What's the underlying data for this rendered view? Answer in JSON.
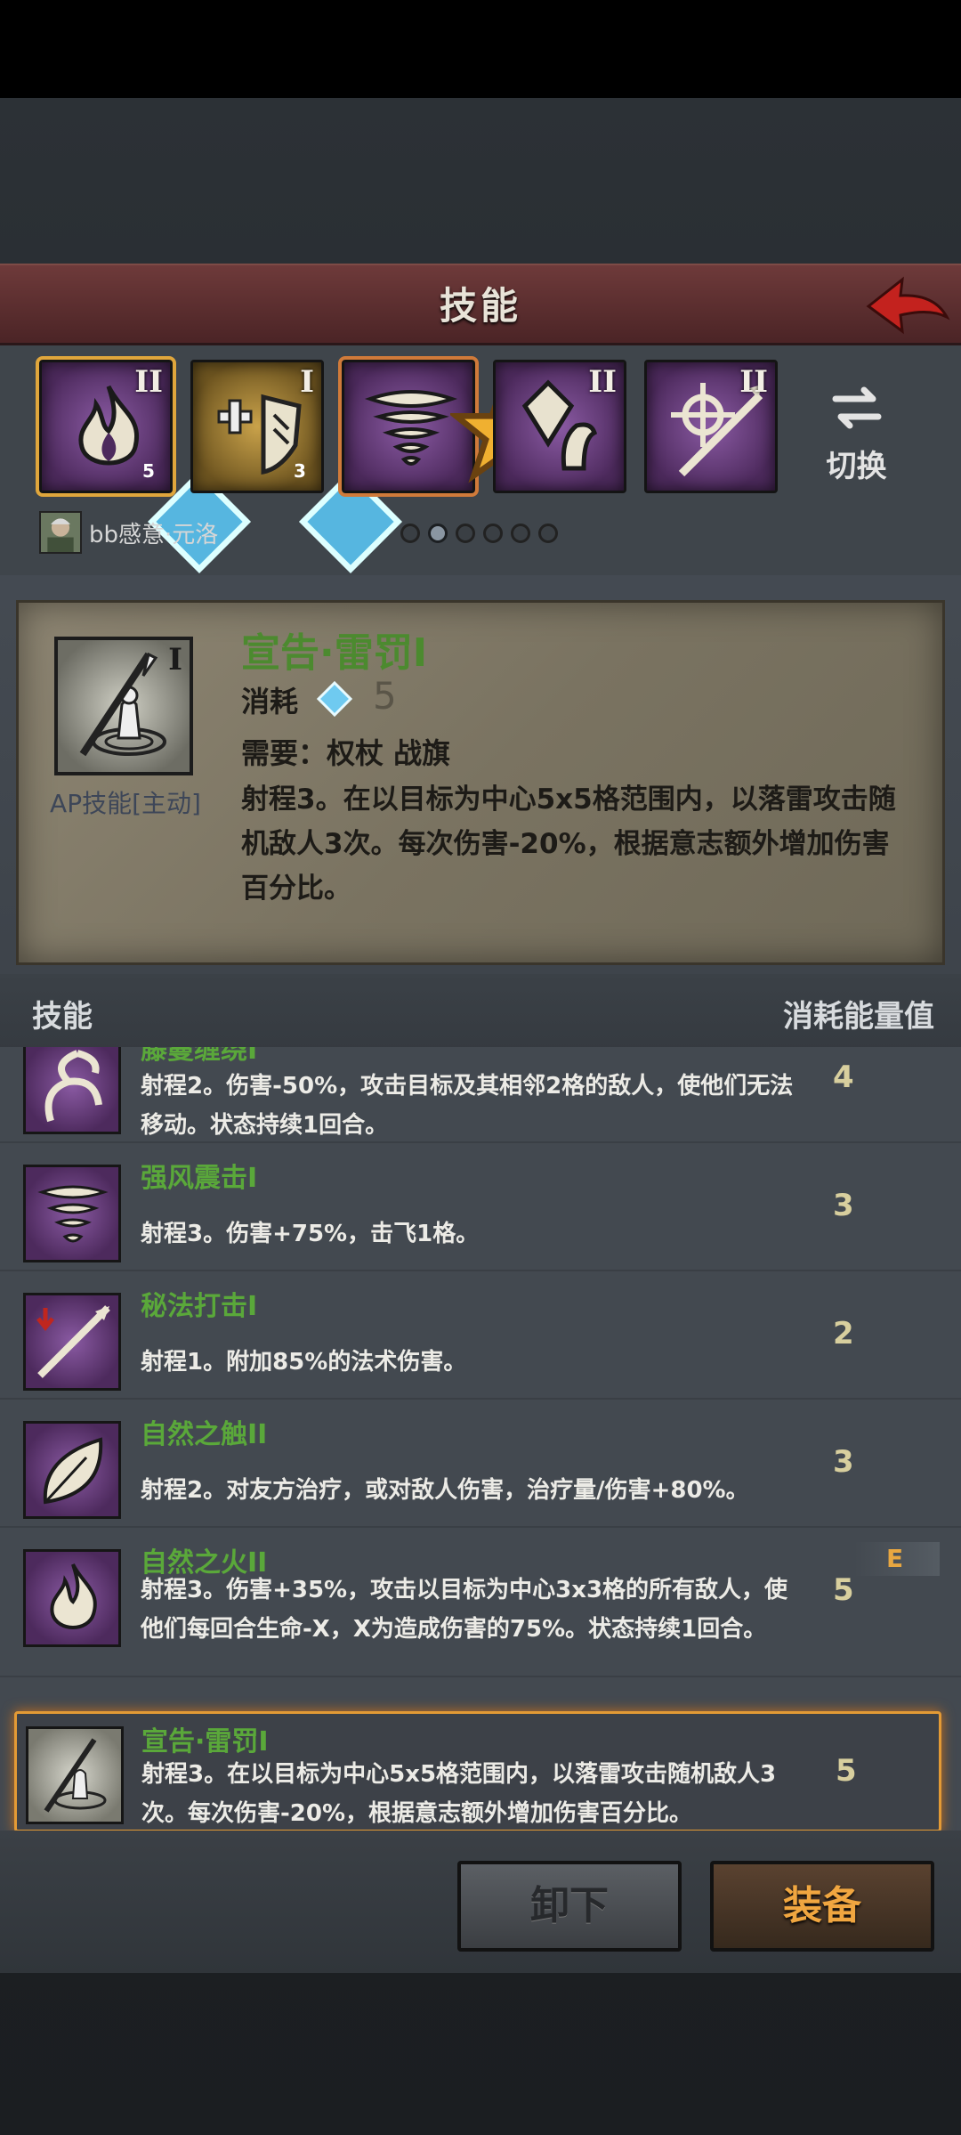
{
  "header": {
    "title": "技能",
    "back_icon": "back-arrow-icon"
  },
  "skill_slots": [
    {
      "icon": "flame-icon",
      "tier": "II",
      "cost": "5",
      "selected": true
    },
    {
      "icon": "heal-shield-icon",
      "tier": "I",
      "cost": "3",
      "gold": true
    },
    {
      "icon": "tornado-icon",
      "tier": "",
      "starred": true
    },
    {
      "icon": "crystal-hand-icon",
      "tier": "II"
    },
    {
      "icon": "target-staff-icon",
      "tier": "II"
    }
  ],
  "switch": {
    "label": "切换",
    "icon": "switch-arrows-icon"
  },
  "character": {
    "name": "bb感意·元洛"
  },
  "pager": {
    "pages": 6,
    "current": 2
  },
  "detail": {
    "name": "宣告·雷罚I",
    "tier": "I",
    "type": "AP技能[主动]",
    "cost_label": "消耗",
    "cost_value": "5",
    "requirement": "需要：权杖 战旗",
    "description": "射程3。在以目标为中心5x5格范围内，以落雷攻击随机敌人3次。每次伤害-20%，根据意志额外增加伤害百分比。"
  },
  "list_header": {
    "left": "技能",
    "right": "消耗能量值"
  },
  "skills": [
    {
      "name": "藤蔓缠绕I",
      "icon": "vine-icon",
      "desc": "射程2。伤害-50%，攻击目标及其相邻2格的敌人，使他们无法移动。状态持续1回合。",
      "cost": "4"
    },
    {
      "name": "强风震击I",
      "icon": "tornado-icon",
      "desc": "射程3。伤害+75%，击飞1格。",
      "cost": "3"
    },
    {
      "name": "秘法打击I",
      "icon": "spear-icon",
      "desc": "射程1。附加85%的法术伤害。",
      "cost": "2"
    },
    {
      "name": "自然之触II",
      "icon": "leaf-icon",
      "desc": "射程2。对友方治疗，或对敌人伤害，治疗量/伤害+80%。",
      "cost": "3"
    },
    {
      "name": "自然之火II",
      "icon": "flame-icon",
      "desc": "射程3。伤害+35%，攻击以目标为中心3x3格的所有敌人，使他们每回合生命-X，X为造成伤害的75%。状态持续1回合。",
      "cost": "5",
      "badge": "E"
    },
    {
      "name": "宣告·雷罚I",
      "icon": "thunder-staff-icon",
      "desc": "射程3。在以目标为中心5x5格范围内，以落雷攻击随机敌人3次。每次伤害-20%，根据意志额外增加伤害百分比。",
      "cost": "5",
      "selected": true
    }
  ],
  "buttons": {
    "unequip": "卸下",
    "equip": "装备"
  },
  "colors": {
    "accent": "#e0a63c",
    "skill_name": "#5aa83a",
    "equip_text": "#f0a640",
    "title_bar": "#6e3a3a"
  }
}
